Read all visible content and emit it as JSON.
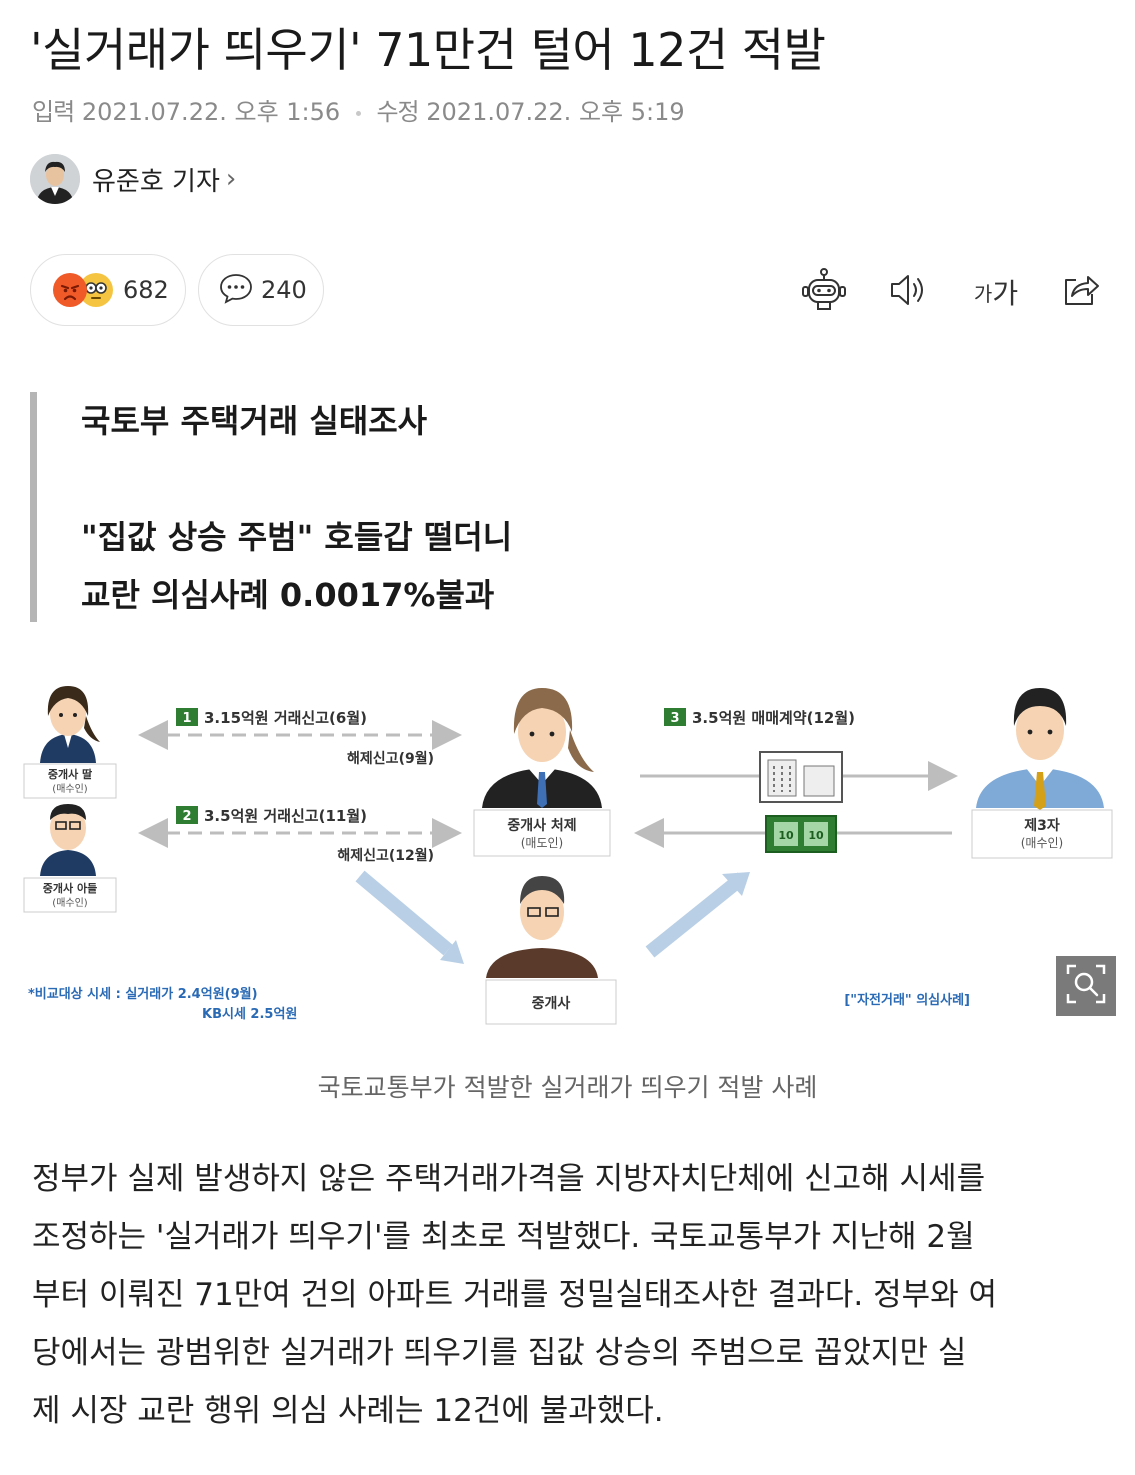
{
  "article": {
    "title": "'실거래가 띄우기' 71만건 털어 12건 적발",
    "input_label": "입력",
    "input_datetime": "2021.07.22. 오후 1:56",
    "edit_label": "수정",
    "edit_datetime": "2021.07.22. 오후 5:19",
    "author": "유준호 기자"
  },
  "reactions": {
    "count": "682"
  },
  "comments": {
    "count": "240"
  },
  "toolbar": {
    "font_label_small": "가",
    "font_label_large": "가"
  },
  "summary": {
    "line1": "국토부 주택거래 실태조사",
    "line2": "\"집값 상승 주범\" 호들갑 떨더니",
    "line3": "교란 의심사례 0.0017%불과"
  },
  "figure": {
    "step1_num": "1",
    "step1_label": "3.15억원 거래신고(6월)",
    "step1_cancel": "해제신고(9월)",
    "step2_num": "2",
    "step2_label": "3.5억원 거래신고(11월)",
    "step2_cancel": "해제신고(12월)",
    "step3_num": "3",
    "step3_label": "3.5억원 매매계약(12월)",
    "broker_a": "중개사 딸",
    "broker_a_role": "(매수인)",
    "broker_b": "중개사 아들",
    "broker_b_role": "(매수인)",
    "broker_sister": "중개사 처제",
    "broker_sister_role": "(매도인)",
    "third_party": "제3자",
    "third_party_role": "(매수인)",
    "broker": "중개사",
    "compare_line1": "*비교대상 시세 : 실거래가 2.4억원(9월)",
    "compare_line2": "KB시세  2.5억원",
    "suspect_case": "[\"자전거래\" 의심사례]",
    "money_label": "10"
  },
  "caption": "국토교통부가 적발한 실거래가 띄우기 적발 사례",
  "body": {
    "line1": "정부가 실제 발생하지 않은 주택거래가격을 지방자치단체에 신고해 시세를",
    "line2": "조정하는 '실거래가 띄우기'를 최초로 적발했다. 국토교통부가 지난해 2월",
    "line3": "부터 이뤄진 71만여 건의 아파트 거래를 정밀실태조사한 결과다. 정부와 여",
    "line4": "당에서는 광범위한 실거래가 띄우기를 집값 상승의 주범으로 꼽았지만 실",
    "line5": "제 시장 교란 행위 의심 사례는 12건에 불과했다."
  },
  "colors": {
    "accent_green": "#2e7d32",
    "arrow_blue": "#b9cfe6",
    "suit_blue": "#1f3b63"
  }
}
